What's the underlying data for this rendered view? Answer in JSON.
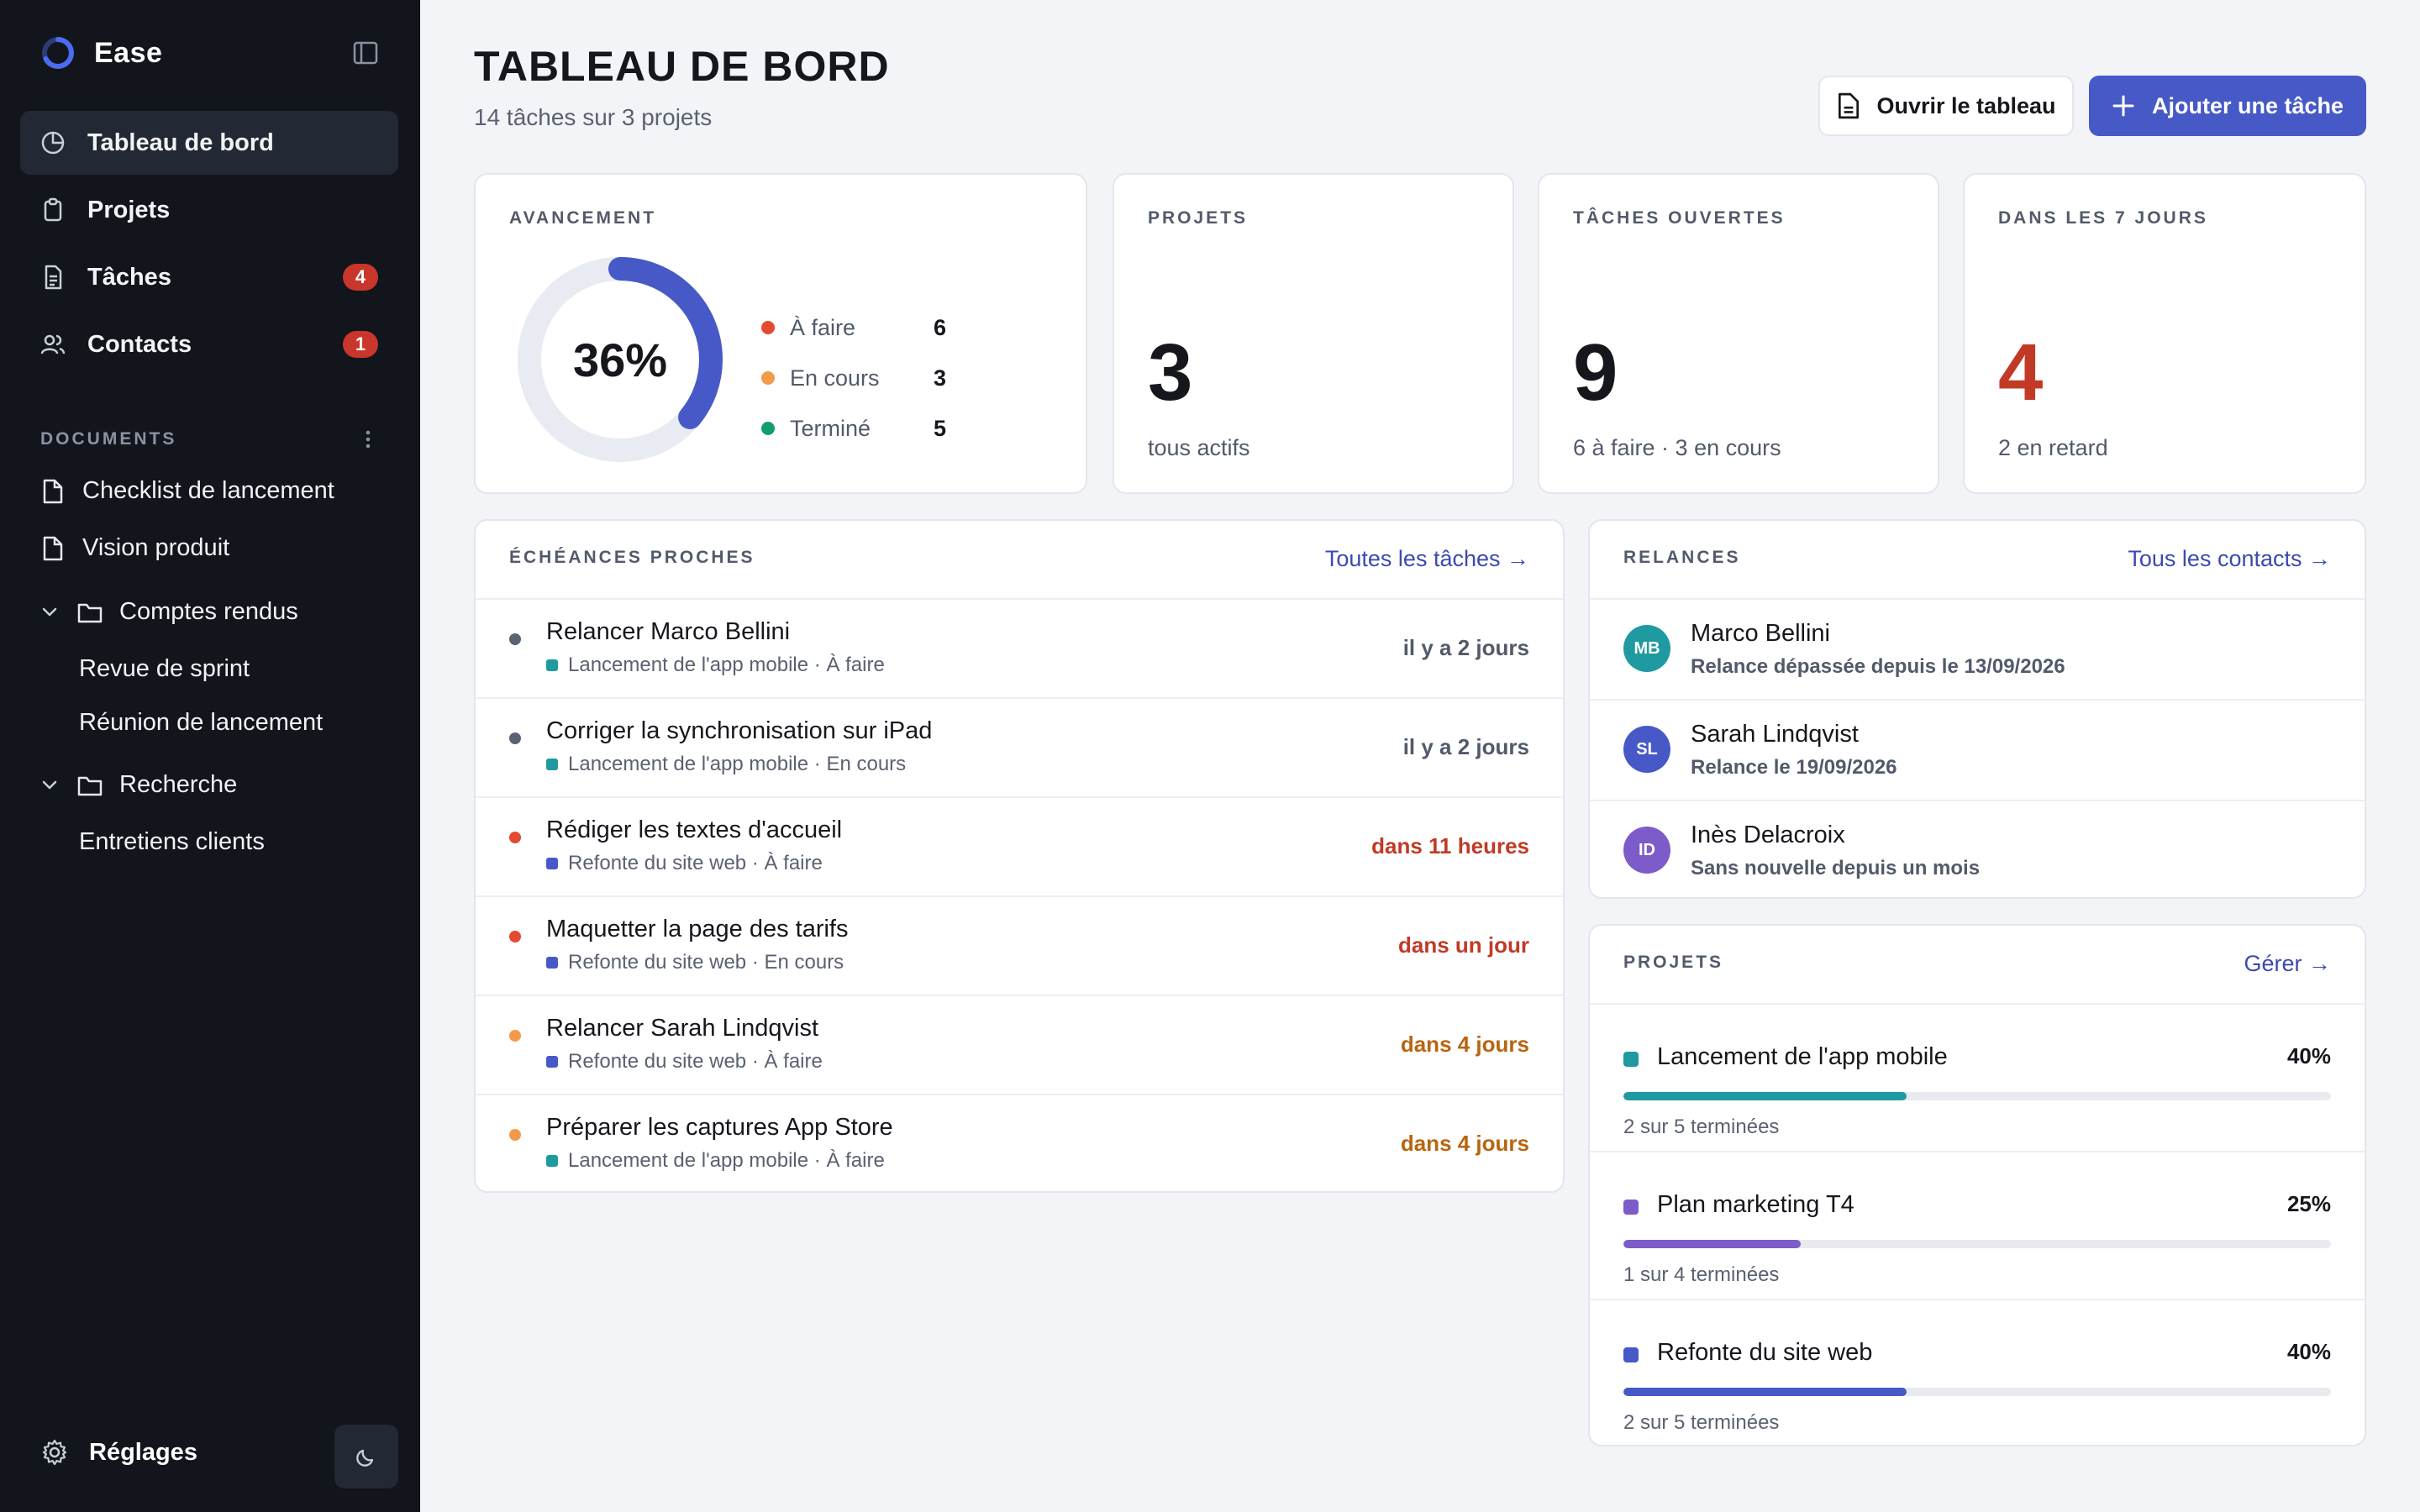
{
  "app": {
    "name": "Ease"
  },
  "sidebar": {
    "nav": [
      {
        "label": "Tableau de bord",
        "icon": "pie-chart-icon",
        "active": true,
        "badge": ""
      },
      {
        "label": "Projets",
        "icon": "clipboard-icon",
        "active": false,
        "badge": ""
      },
      {
        "label": "Tâches",
        "icon": "file-list-icon",
        "active": false,
        "badge": "4"
      },
      {
        "label": "Contacts",
        "icon": "users-icon",
        "active": false,
        "badge": "1"
      }
    ],
    "documents_title": "DOCUMENTS",
    "documents": {
      "doc1": "Checklist de lancement",
      "doc2": "Vision produit",
      "folder1": "Comptes rendus",
      "folder1_items": [
        "Revue de sprint",
        "Réunion de lancement"
      ],
      "folder2": "Recherche",
      "folder2_items": [
        "Entretiens clients"
      ]
    },
    "settings_label": "Réglages"
  },
  "header": {
    "title": "TABLEAU DE BORD",
    "subtitle": "14 tâches sur 3 projets",
    "open_board": "Ouvrir le tableau",
    "add_task": "Ajouter une tâche"
  },
  "progress": {
    "label": "AVANCEMENT",
    "percent_label": "36%",
    "percent": 0.36,
    "legend": [
      {
        "label": "À faire",
        "value": "6",
        "color": "#e24a32"
      },
      {
        "label": "En cours",
        "value": "3",
        "color": "#f29a4a"
      },
      {
        "label": "Terminé",
        "value": "5",
        "color": "#139e6d"
      }
    ]
  },
  "stats": [
    {
      "label": "PROJETS",
      "value": "3",
      "sub": "tous actifs",
      "color": "#15171c"
    },
    {
      "label": "TÂCHES OUVERTES",
      "value": "9",
      "sub": "6 à faire · 3 en cours",
      "color": "#15171c"
    },
    {
      "label": "DANS LES 7 JOURS",
      "value": "4",
      "sub": "2 en retard",
      "color": "#c13a26"
    }
  ],
  "deadlines": {
    "label": "ÉCHÉANCES PROCHES",
    "link": "Toutes les tâches →",
    "rows": [
      {
        "title": "Relancer Marco Bellini",
        "project": "Lancement de l'app mobile",
        "status": "· À faire",
        "when": "il y a 2 jours",
        "dot": "#5b6274",
        "proj_color": "#1f9aa0",
        "when_color": "#525a6a"
      },
      {
        "title": "Corriger la synchronisation sur iPad",
        "project": "Lancement de l'app mobile",
        "status": "· En cours",
        "when": "il y a 2 jours",
        "dot": "#5b6274",
        "proj_color": "#1f9aa0",
        "when_color": "#525a6a"
      },
      {
        "title": "Rédiger les textes d'accueil",
        "project": "Refonte du site web",
        "status": "· À faire",
        "when": "dans 11 heures",
        "dot": "#e24a32",
        "proj_color": "#4659c6",
        "when_color": "#c13a26"
      },
      {
        "title": "Maquetter la page des tarifs",
        "project": "Refonte du site web",
        "status": "· En cours",
        "when": "dans un jour",
        "dot": "#e24a32",
        "proj_color": "#4659c6",
        "when_color": "#c13a26"
      },
      {
        "title": "Relancer Sarah Lindqvist",
        "project": "Refonte du site web",
        "status": "· À faire",
        "when": "dans 4 jours",
        "dot": "#f29a4a",
        "proj_color": "#4659c6",
        "when_color": "#b8650f"
      },
      {
        "title": "Préparer les captures App Store",
        "project": "Lancement de l'app mobile",
        "status": "· À faire",
        "when": "dans 4 jours",
        "dot": "#f29a4a",
        "proj_color": "#1f9aa0",
        "when_color": "#b8650f"
      }
    ]
  },
  "followups": {
    "label": "RELANCES",
    "link": "Tous les contacts →",
    "rows": [
      {
        "initials": "MB",
        "name": "Marco Bellini",
        "note": "Relance dépassée depuis le 13/09/2026",
        "color": "#1f9aa0"
      },
      {
        "initials": "SL",
        "name": "Sarah Lindqvist",
        "note": "Relance le 19/09/2026",
        "color": "#4659c6"
      },
      {
        "initials": "ID",
        "name": "Inès Delacroix",
        "note": "Sans nouvelle depuis un mois",
        "color": "#7d5cc9"
      }
    ]
  },
  "projects": {
    "label": "PROJETS",
    "link": "Gérer →",
    "rows": [
      {
        "name": "Lancement de l'app mobile",
        "percent_label": "40%",
        "progress": 0.4,
        "sub": "2 sur 5 terminées",
        "color": "#1f9aa0"
      },
      {
        "name": "Plan marketing T4",
        "percent_label": "25%",
        "progress": 0.25,
        "sub": "1 sur 4 terminées",
        "color": "#7d5cc9"
      },
      {
        "name": "Refonte du site web",
        "percent_label": "40%",
        "progress": 0.4,
        "sub": "2 sur 5 terminées",
        "color": "#4659c6"
      }
    ]
  }
}
